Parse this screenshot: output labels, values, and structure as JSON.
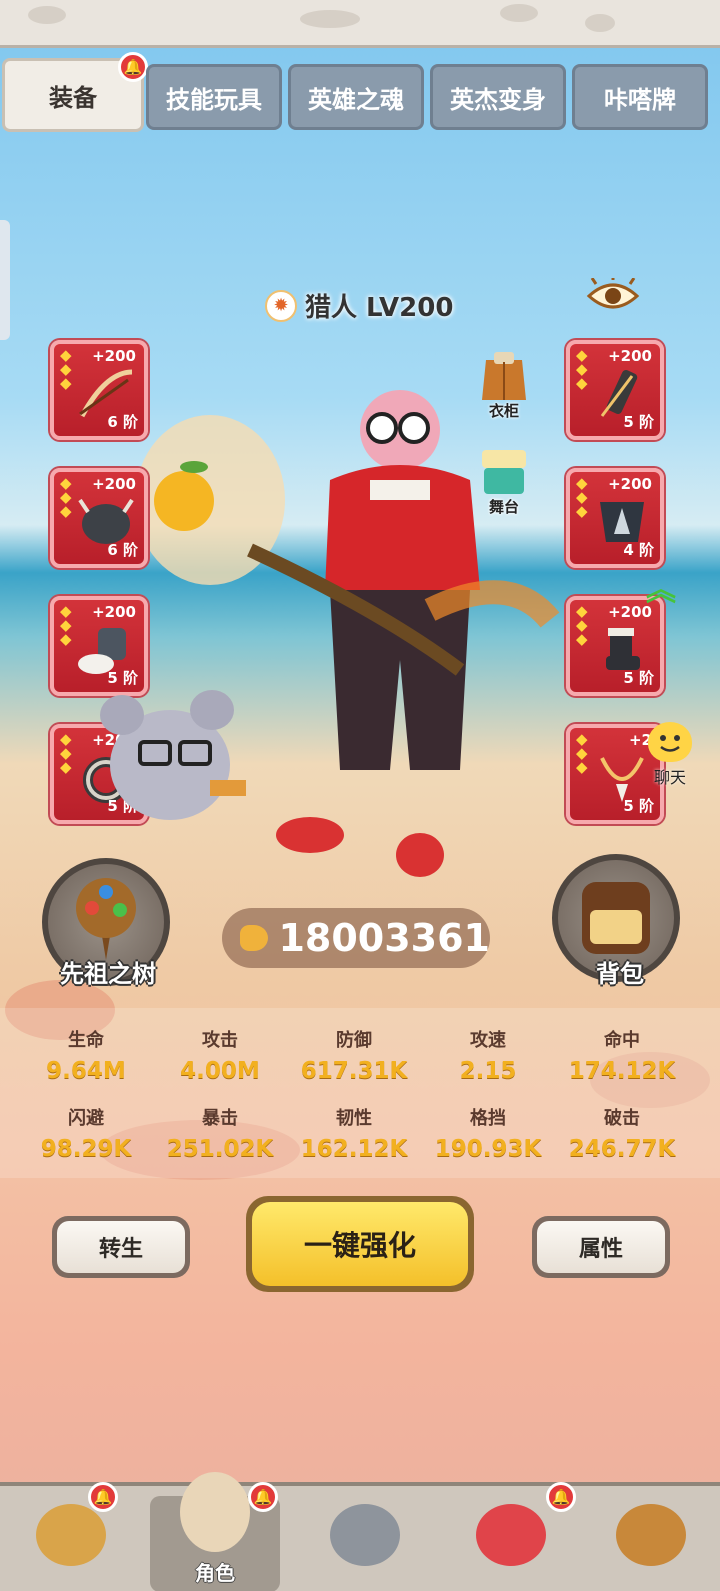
{
  "tabs": [
    {
      "label": "装备",
      "active": true,
      "badge": true
    },
    {
      "label": "技能玩具",
      "active": false
    },
    {
      "label": "英雄之魂",
      "active": false
    },
    {
      "label": "英杰变身",
      "active": false
    },
    {
      "label": "咔嗒牌",
      "active": false
    }
  ],
  "hero": {
    "class_icon": "claw-icon",
    "name": "猎人 LV200"
  },
  "left_slots": [
    {
      "bonus": "+200",
      "tier": "6 阶",
      "stars": 3,
      "icon": "bow-icon"
    },
    {
      "bonus": "+200",
      "tier": "6 阶",
      "stars": 3,
      "icon": "helmet-icon"
    },
    {
      "bonus": "+200",
      "tier": "5 阶",
      "stars": 3,
      "icon": "glove-icon"
    },
    {
      "bonus": "+200",
      "tier": "5 阶",
      "stars": 3,
      "icon": "ring-icon"
    }
  ],
  "right_slots": [
    {
      "bonus": "+200",
      "tier": "5 阶",
      "stars": 3,
      "icon": "arrows-icon"
    },
    {
      "bonus": "+200",
      "tier": "4 阶",
      "stars": 3,
      "icon": "armor-icon"
    },
    {
      "bonus": "+200",
      "tier": "5 阶",
      "stars": 3,
      "icon": "boots-icon"
    },
    {
      "bonus": "+2",
      "tier": "5 阶",
      "stars": 3,
      "icon": "necklace-icon"
    }
  ],
  "outfit": {
    "wardrobe": "衣柜",
    "stage": "舞台"
  },
  "chat": "聊天",
  "ancestor_tree": "先祖之树",
  "backpack": "背包",
  "power": "18003361",
  "stats": [
    {
      "label": "生命",
      "value": "9.64M"
    },
    {
      "label": "攻击",
      "value": "4.00M"
    },
    {
      "label": "防御",
      "value": "617.31K"
    },
    {
      "label": "攻速",
      "value": "2.15"
    },
    {
      "label": "命中",
      "value": "174.12K"
    },
    {
      "label": "闪避",
      "value": "98.29K"
    },
    {
      "label": "暴击",
      "value": "251.02K"
    },
    {
      "label": "韧性",
      "value": "162.12K"
    },
    {
      "label": "格挡",
      "value": "190.93K"
    },
    {
      "label": "破击",
      "value": "246.77K"
    }
  ],
  "buttons": {
    "rebirth": "转生",
    "enhance_all": "一键强化",
    "attributes": "属性"
  },
  "nav": [
    {
      "label": "",
      "icon": "nest-icon",
      "badge": true
    },
    {
      "label": "角色",
      "icon": "character-icon",
      "badge": true,
      "active": true
    },
    {
      "label": "",
      "icon": "sword-icon"
    },
    {
      "label": "",
      "icon": "pet-icon",
      "badge": true
    },
    {
      "label": "",
      "icon": "tribe-icon"
    }
  ],
  "colors": {
    "slot_red": "#c8262f",
    "stat_value": "#f2b01f",
    "enhance_button": "#f4c02a"
  }
}
